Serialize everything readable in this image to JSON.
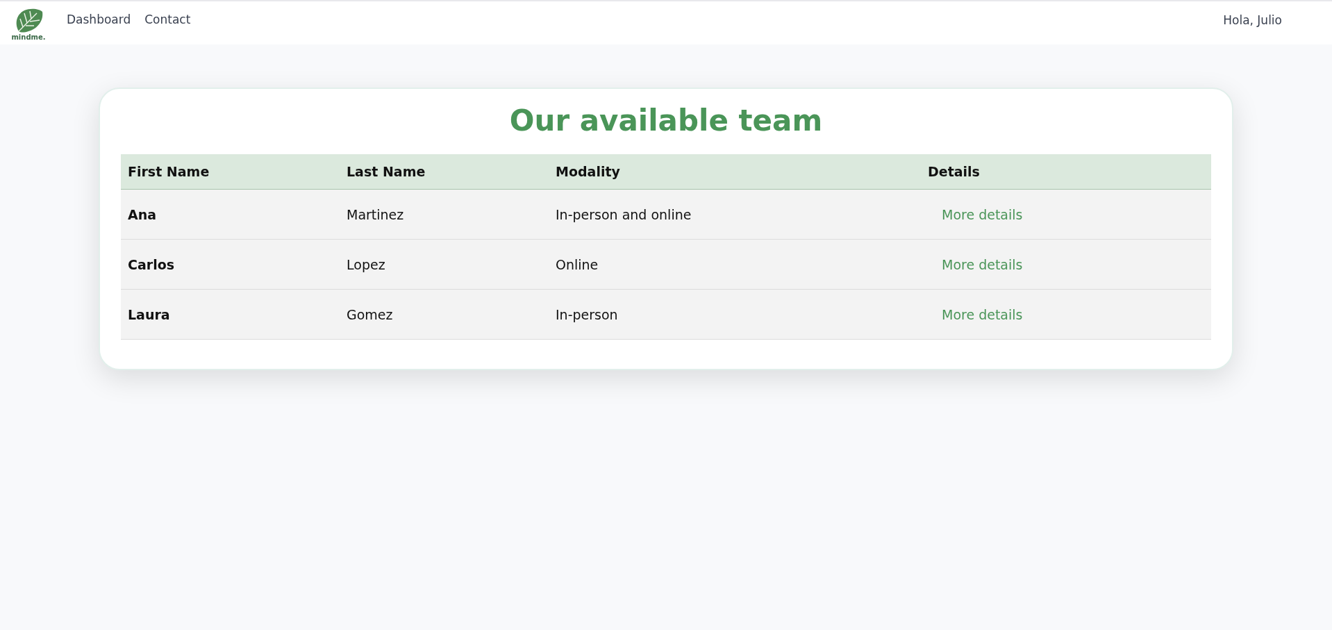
{
  "header": {
    "logo_text": "mindme.",
    "nav": [
      "Dashboard",
      "Contact"
    ],
    "greeting": "Hola, Julio"
  },
  "card": {
    "title": "Our available team",
    "table": {
      "columns": [
        "First Name",
        "Last Name",
        "Modality",
        "Details"
      ],
      "rows": [
        {
          "first_name": "Ana",
          "last_name": "Martinez",
          "modality": "In-person and online",
          "details": "More details"
        },
        {
          "first_name": "Carlos",
          "last_name": "Lopez",
          "modality": "Online",
          "details": "More details"
        },
        {
          "first_name": "Laura",
          "last_name": "Gomez",
          "modality": "In-person",
          "details": "More details"
        }
      ]
    }
  }
}
